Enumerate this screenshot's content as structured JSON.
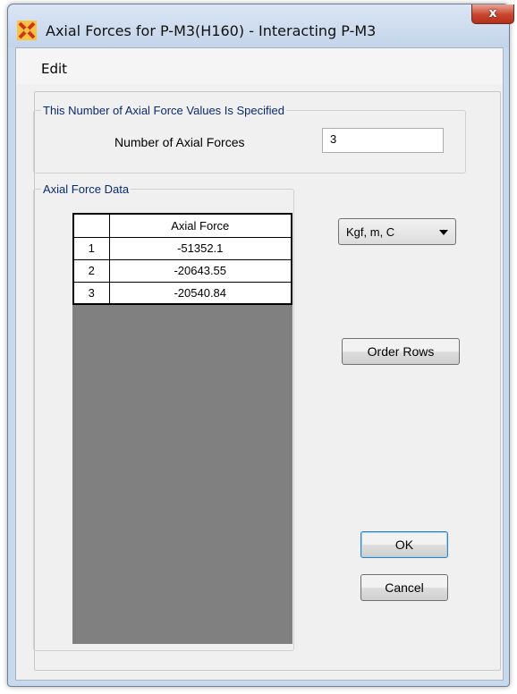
{
  "window": {
    "title": "Axial Forces for  P-M3(H160) - Interacting P-M3",
    "close_label": "x",
    "colors": {
      "title_bar": "#c3d4ea",
      "close_button": "#c8442f"
    }
  },
  "menu": {
    "edit_label": "Edit"
  },
  "axial_count_group": {
    "legend": "This Number of Axial Force Values Is Specified",
    "number_label": "Number of Axial Forces",
    "number_value": "3"
  },
  "axial_data_group": {
    "legend": "Axial Force Data",
    "table": {
      "column_header": "Axial Force",
      "rows": [
        {
          "index": "1",
          "value": "-51352.1"
        },
        {
          "index": "2",
          "value": "-20643.55"
        },
        {
          "index": "3",
          "value": "-20540.84"
        }
      ]
    }
  },
  "units": {
    "selected": "Kgf, m, C"
  },
  "buttons": {
    "order_rows": "Order Rows",
    "ok": "OK",
    "cancel": "Cancel"
  },
  "icons": {
    "app_icon": "sap-app-icon",
    "dropdown": "chevron-down-icon"
  }
}
